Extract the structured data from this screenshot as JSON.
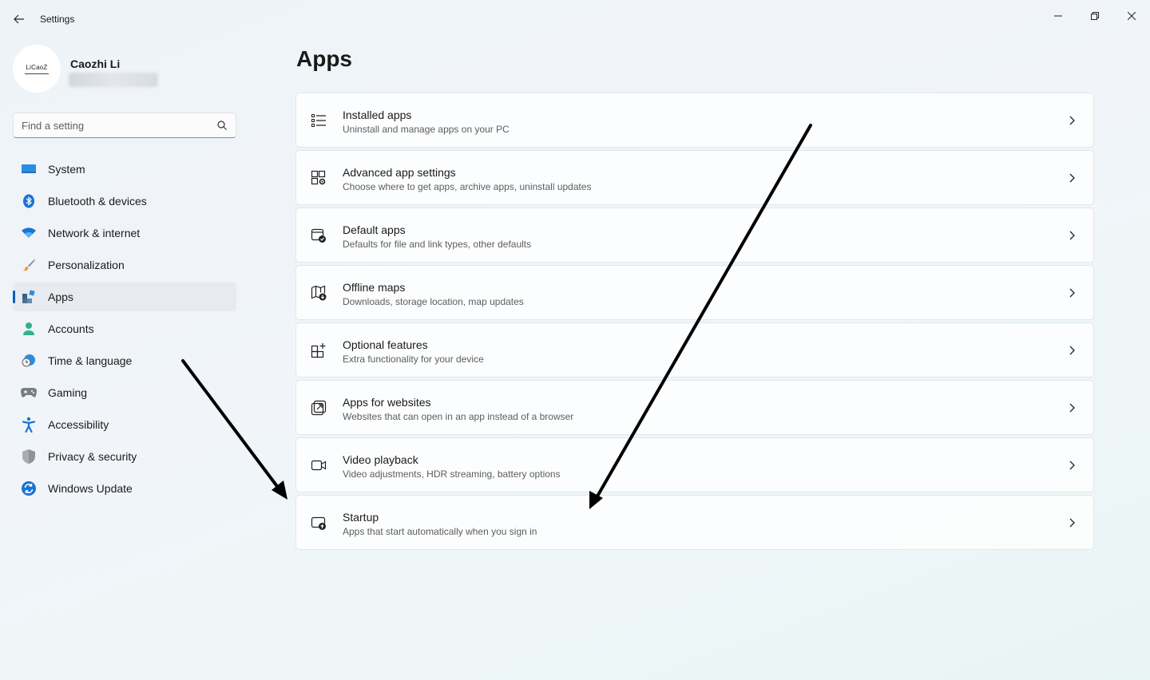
{
  "window": {
    "title": "Settings"
  },
  "profile": {
    "avatar_text": "LiCaoZ",
    "name": "Caozhi Li"
  },
  "search": {
    "placeholder": "Find a setting"
  },
  "nav": {
    "items": [
      {
        "label": "System",
        "icon": "system-icon"
      },
      {
        "label": "Bluetooth & devices",
        "icon": "bluetooth-icon"
      },
      {
        "label": "Network & internet",
        "icon": "wifi-icon"
      },
      {
        "label": "Personalization",
        "icon": "brush-icon"
      },
      {
        "label": "Apps",
        "icon": "apps-icon",
        "selected": true
      },
      {
        "label": "Accounts",
        "icon": "person-icon"
      },
      {
        "label": "Time & language",
        "icon": "clock-globe-icon"
      },
      {
        "label": "Gaming",
        "icon": "gamepad-icon"
      },
      {
        "label": "Accessibility",
        "icon": "accessibility-icon"
      },
      {
        "label": "Privacy & security",
        "icon": "shield-icon"
      },
      {
        "label": "Windows Update",
        "icon": "update-icon"
      }
    ]
  },
  "main": {
    "title": "Apps",
    "items": [
      {
        "title": "Installed apps",
        "subtitle": "Uninstall and manage apps on your PC",
        "icon": "list-icon"
      },
      {
        "title": "Advanced app settings",
        "subtitle": "Choose where to get apps, archive apps, uninstall updates",
        "icon": "app-settings-icon"
      },
      {
        "title": "Default apps",
        "subtitle": "Defaults for file and link types, other defaults",
        "icon": "default-apps-icon"
      },
      {
        "title": "Offline maps",
        "subtitle": "Downloads, storage location, map updates",
        "icon": "map-icon"
      },
      {
        "title": "Optional features",
        "subtitle": "Extra functionality for your device",
        "icon": "add-grid-icon"
      },
      {
        "title": "Apps for websites",
        "subtitle": "Websites that can open in an app instead of a browser",
        "icon": "open-link-icon"
      },
      {
        "title": "Video playback",
        "subtitle": "Video adjustments, HDR streaming, battery options",
        "icon": "video-icon"
      },
      {
        "title": "Startup",
        "subtitle": "Apps that start automatically when you sign in",
        "icon": "startup-icon"
      }
    ]
  },
  "colors": {
    "accent": "#005fb8",
    "selected_bg": "#e7ebef",
    "annotation": "#000000"
  }
}
